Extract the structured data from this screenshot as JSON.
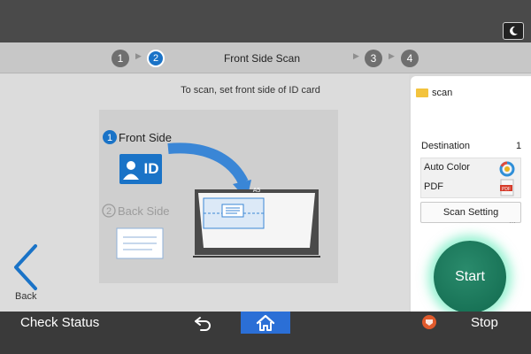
{
  "steps": [
    {
      "number": "1",
      "state": "done"
    },
    {
      "number": "2",
      "state": "active"
    },
    {
      "number": "3",
      "state": "pending"
    },
    {
      "number": "4",
      "state": "pending"
    }
  ],
  "step_title": "Front Side Scan",
  "instruction": "To scan, set front side of ID card",
  "illustration": {
    "front_number": "1",
    "front_label": "Front Side",
    "back_number": "2",
    "back_label": "Back Side",
    "id_text": "ID",
    "scanner_size": "A5"
  },
  "back_button_label": "Back",
  "side_panel": {
    "folder_name": "scan",
    "destination_label": "Destination",
    "destination_count": "1",
    "color_mode": "Auto Color",
    "file_format": "PDF",
    "file_format_icon_text": "PDF",
    "scan_setting_label": "Scan Setting"
  },
  "start_label": "Start",
  "bottom": {
    "check_status_label": "Check Status",
    "stop_label": "Stop"
  },
  "colors": {
    "accent_blue": "#1a73c7",
    "start_green": "#11694e",
    "start_glow": "#3ce6aa",
    "stop_orange": "#e05a2c",
    "home_blue": "#2b6fd6"
  }
}
